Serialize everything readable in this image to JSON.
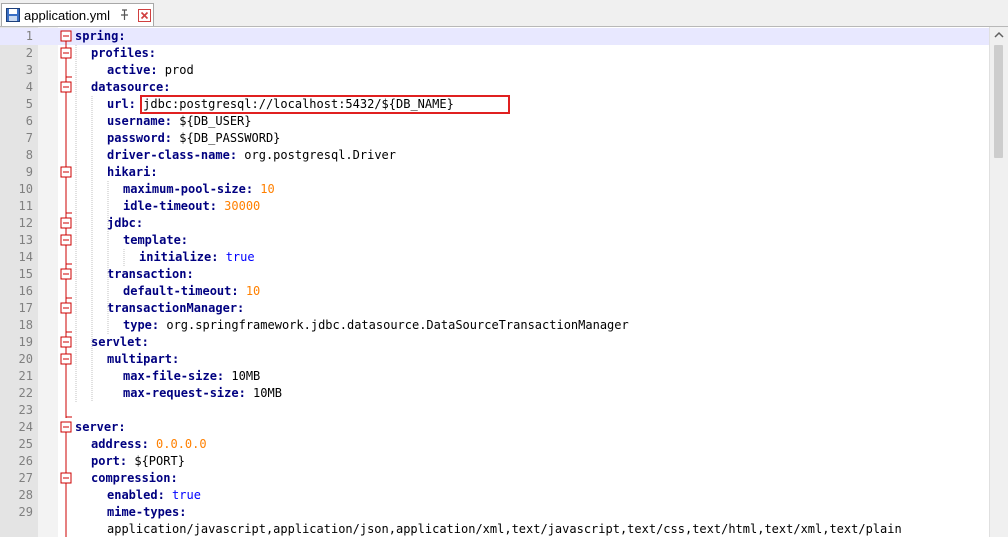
{
  "tab": {
    "title": "application.yml",
    "file_icon": "save-floppy-icon",
    "pin_icon": "pin-icon",
    "close_icon": "close-icon"
  },
  "colors": {
    "key": "#000080",
    "number": "#ff8000",
    "boolean": "#0000ff",
    "fold_line": "#cc0000",
    "current_line": "#e8e8ff",
    "highlight_box": "#e02020"
  },
  "editor": {
    "current_line": 1,
    "highlighted_line": 5,
    "lines": [
      {
        "n": "1",
        "indent": 0,
        "key": "spring:",
        "value": "",
        "vtype": "s",
        "fold": "open"
      },
      {
        "n": "2",
        "indent": 2,
        "key": "profiles:",
        "value": "",
        "vtype": "s",
        "fold": "open"
      },
      {
        "n": "3",
        "indent": 4,
        "key": "active:",
        "value": " prod",
        "vtype": "s",
        "fold": "end"
      },
      {
        "n": "4",
        "indent": 2,
        "key": "datasource:",
        "value": "",
        "vtype": "s",
        "fold": "open"
      },
      {
        "n": "5",
        "indent": 4,
        "key": "url:",
        "value": " jdbc:postgresql://localhost:5432/${DB_NAME}",
        "vtype": "s",
        "fold": "line"
      },
      {
        "n": "6",
        "indent": 4,
        "key": "username:",
        "value": " ${DB_USER}",
        "vtype": "s",
        "fold": "line"
      },
      {
        "n": "7",
        "indent": 4,
        "key": "password:",
        "value": " ${DB_PASSWORD}",
        "vtype": "s",
        "fold": "line"
      },
      {
        "n": "8",
        "indent": 4,
        "key": "driver-class-name:",
        "value": " org.postgresql.Driver",
        "vtype": "s",
        "fold": "line"
      },
      {
        "n": "9",
        "indent": 4,
        "key": "hikari:",
        "value": "",
        "vtype": "s",
        "fold": "open"
      },
      {
        "n": "10",
        "indent": 6,
        "key": "maximum-pool-size:",
        "value": " 10",
        "vtype": "n",
        "fold": "line"
      },
      {
        "n": "11",
        "indent": 6,
        "key": "idle-timeout:",
        "value": " 30000",
        "vtype": "n",
        "fold": "end"
      },
      {
        "n": "12",
        "indent": 4,
        "key": "jdbc:",
        "value": "",
        "vtype": "s",
        "fold": "open"
      },
      {
        "n": "13",
        "indent": 6,
        "key": "template:",
        "value": "",
        "vtype": "s",
        "fold": "open"
      },
      {
        "n": "14",
        "indent": 8,
        "key": "initialize:",
        "value": " true",
        "vtype": "b",
        "fold": "end"
      },
      {
        "n": "15",
        "indent": 4,
        "key": "transaction:",
        "value": "",
        "vtype": "s",
        "fold": "open"
      },
      {
        "n": "16",
        "indent": 6,
        "key": "default-timeout:",
        "value": " 10",
        "vtype": "n",
        "fold": "end"
      },
      {
        "n": "17",
        "indent": 4,
        "key": "transactionManager:",
        "value": "",
        "vtype": "s",
        "fold": "open"
      },
      {
        "n": "18",
        "indent": 6,
        "key": "type:",
        "value": " org.springframework.jdbc.datasource.DataSourceTransactionManager",
        "vtype": "s",
        "fold": "end"
      },
      {
        "n": "19",
        "indent": 2,
        "key": "servlet:",
        "value": "",
        "vtype": "s",
        "fold": "open"
      },
      {
        "n": "20",
        "indent": 4,
        "key": "multipart:",
        "value": "",
        "vtype": "s",
        "fold": "open"
      },
      {
        "n": "21",
        "indent": 6,
        "key": "max-file-size:",
        "value": " 10MB",
        "vtype": "s",
        "fold": "line"
      },
      {
        "n": "22",
        "indent": 6,
        "key": "max-request-size:",
        "value": " 10MB",
        "vtype": "s",
        "fold": "line"
      },
      {
        "n": "23",
        "indent": 0,
        "key": "",
        "value": "",
        "vtype": "s",
        "fold": "end"
      },
      {
        "n": "24",
        "indent": 0,
        "key": "server:",
        "value": "",
        "vtype": "s",
        "fold": "open"
      },
      {
        "n": "25",
        "indent": 2,
        "key": "address:",
        "value": " 0.0.0.0",
        "vtype": "n",
        "fold": "line"
      },
      {
        "n": "26",
        "indent": 2,
        "key": "port:",
        "value": " ${PORT}",
        "vtype": "s",
        "fold": "line"
      },
      {
        "n": "27",
        "indent": 2,
        "key": "compression:",
        "value": "",
        "vtype": "s",
        "fold": "open"
      },
      {
        "n": "28",
        "indent": 4,
        "key": "enabled:",
        "value": " true",
        "vtype": "b",
        "fold": "line"
      },
      {
        "n": "29",
        "indent": 4,
        "key": "mime-types:",
        "value": "",
        "vtype": "s",
        "fold": "line"
      },
      {
        "n": "",
        "indent": 4,
        "key": "",
        "value": "application/javascript,application/json,application/xml,text/javascript,text/css,text/html,text/xml,text/plain",
        "vtype": "s",
        "fold": "line"
      }
    ]
  }
}
